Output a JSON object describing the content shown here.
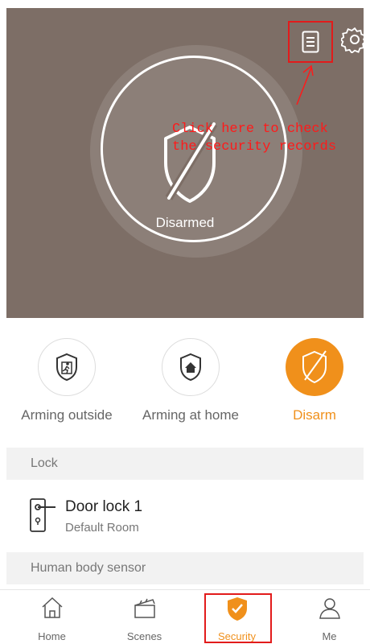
{
  "hero": {
    "status": "Disarmed",
    "annotation": "Click here to check\nthe security records",
    "records_icon": "document-list-icon",
    "settings_icon": "gear-icon"
  },
  "modes": [
    {
      "label": "Arming outside",
      "icon": "person-leaving-shield-icon",
      "active": false
    },
    {
      "label": "Arming at home",
      "icon": "home-shield-icon",
      "active": false
    },
    {
      "label": "Disarm",
      "icon": "shield-slash-icon",
      "active": true
    }
  ],
  "sections": {
    "lock_header": "Lock",
    "sensor_header": "Human body sensor"
  },
  "device": {
    "name": "Door lock 1",
    "room": "Default Room",
    "icon": "door-lock-icon"
  },
  "tabs": [
    {
      "label": "Home",
      "icon": "home-icon"
    },
    {
      "label": "Scenes",
      "icon": "clapperboard-icon"
    },
    {
      "label": "Security",
      "icon": "security-shield-icon",
      "active": true
    },
    {
      "label": "Me",
      "icon": "person-icon"
    }
  ],
  "colors": {
    "hero_bg": "#7d6e66",
    "accent": "#f0901b",
    "annotation": "#ff1a1a"
  }
}
